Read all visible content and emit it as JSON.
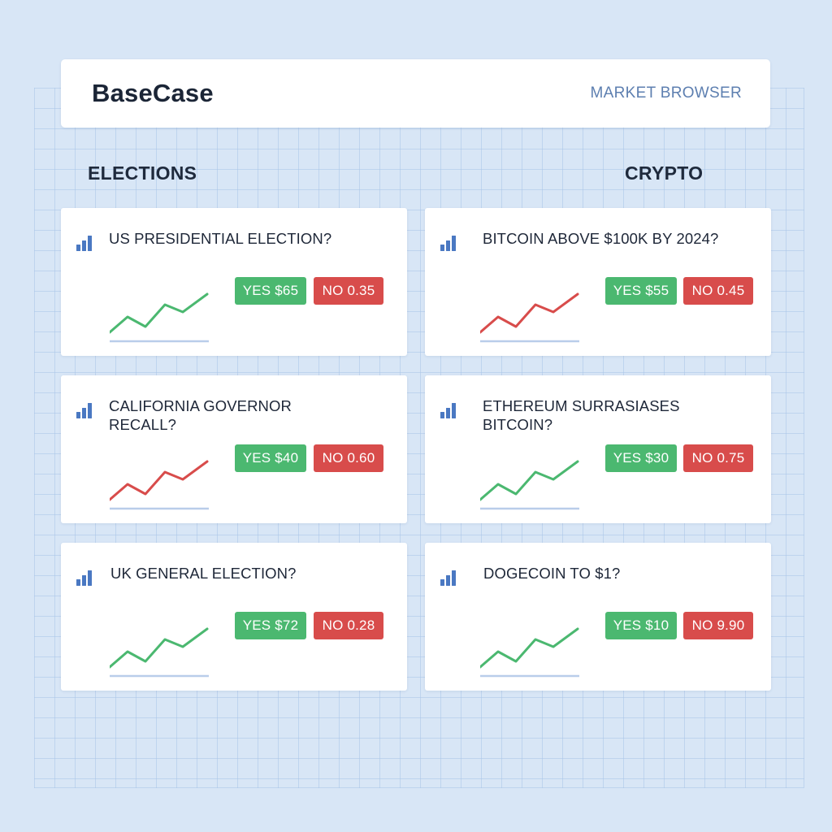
{
  "header": {
    "brand": "BaseCase",
    "nav_link": "MARKET BROWSER"
  },
  "sections": {
    "left_title": "ELECTIONS",
    "right_title": "CRYPTO"
  },
  "colors": {
    "up": "#4bb870",
    "down": "#d84c4b",
    "icon": "#4a78c2",
    "baseline": "#b9cdea"
  },
  "icons": {
    "card_icon": "bar-chart-icon"
  },
  "markets": [
    {
      "question": "US PRESIDENTIAL ELECTION?",
      "yes": "YES $65",
      "no": "NO 0.35",
      "trend": "up"
    },
    {
      "question": "BITCOIN ABOVE $100K BY 2024?",
      "yes": "YES $55",
      "no": "NO 0.45",
      "trend": "down"
    },
    {
      "question": "CALIFORNIA GOVERNOR RECALL?",
      "yes": "YES $40",
      "no": "NO 0.60",
      "trend": "down"
    },
    {
      "question": "ETHEREUM SURRASIASES BITCOIN?",
      "yes": "YES $30",
      "no": "NO 0.75",
      "trend": "up"
    },
    {
      "question": "UK GENERAL ELECTION?",
      "yes": "YES $72",
      "no": "NO 0.28",
      "trend": "up"
    },
    {
      "question": "DOGECOIN TO $1?",
      "yes": "YES $10",
      "no": "NO 9.90",
      "trend": "up"
    }
  ]
}
